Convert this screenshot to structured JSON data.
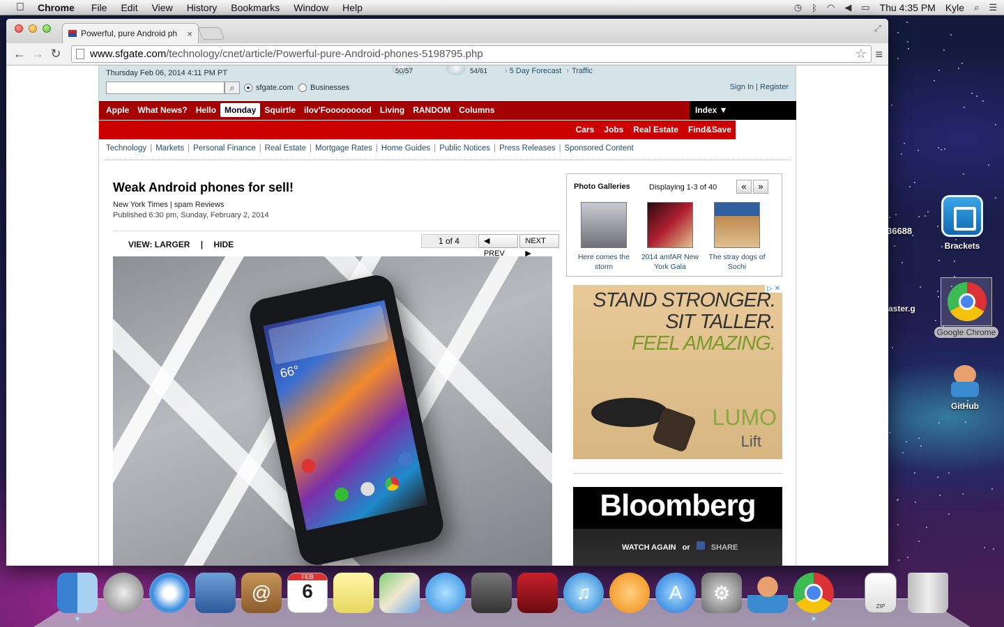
{
  "menubar": {
    "apple": "",
    "app": "Chrome",
    "items": [
      "File",
      "Edit",
      "View",
      "History",
      "Bookmarks",
      "Window",
      "Help"
    ],
    "clock": "Thu 4:35 PM",
    "user": "Kyle"
  },
  "browser": {
    "tab_title": "Powerful, pure Android ph",
    "tab_close": "×",
    "url_host": "www.sfgate.com",
    "url_path": "/technology/cnet/article/Powerful-pure-Android-phones-5198795.php",
    "star": "☆",
    "menu": "≡",
    "back": "←",
    "forward": "→",
    "reload": "↻",
    "fullscreen": "⤢"
  },
  "header": {
    "date": "Thursday Feb 06, 2014 4:11 PM PT",
    "weather1": "50/57",
    "weather2": "54/61",
    "forecast": "5 Day Forecast",
    "traffic": "Traffic",
    "radio1": "sfgate.com",
    "radio2": "Businesses",
    "signin": "Sign In",
    "register": "Register",
    "signin_sep": "|"
  },
  "nav": {
    "items": [
      "Apple",
      "What News?",
      "Hello",
      "Monday",
      "Squirtle",
      "ilov'Fooooooood",
      "Living",
      "RANDOM",
      "Columns"
    ],
    "active": "Monday",
    "index": "Index ▼",
    "sub": [
      "Cars",
      "Jobs",
      "Real Estate",
      "Find&Save"
    ]
  },
  "sections": [
    "Technology",
    "Markets",
    "Personal Finance",
    "Real Estate",
    "Mortgage Rates",
    "Home Guides",
    "Public Notices",
    "Press Releases",
    "Sponsored Content"
  ],
  "article": {
    "headline": "Weak Android phones for sell!",
    "byline": "New York Times | spam Reviews",
    "published": "Published 6:30 pm, Sunday, February 2, 2014",
    "view_larger": "VIEW: LARGER",
    "view_sep": "|",
    "hide": "HIDE",
    "page_count": "1 of 4",
    "prev": "◀ PREV",
    "next": "NEXT ▶",
    "phone_temp": "66°"
  },
  "galleries": {
    "title": "Photo Galleries",
    "count": "Displaying 1-3 of 40",
    "prev": "«",
    "next": "»",
    "items": [
      {
        "caption": "Here comes the storm",
        "color": "#8a8e94"
      },
      {
        "caption": "2014 amfAR New York Gala",
        "color": "#7a2030"
      },
      {
        "caption": "The stray dogs of Sochi",
        "color": "#b07a3a"
      }
    ]
  },
  "ad": {
    "line1": "STAND STRONGER.",
    "line2": "SIT TALLER.",
    "line3": "FEEL AMAZING.",
    "brand": "LUMO",
    "product": "Lift",
    "badge": "▷ ✕"
  },
  "bloomberg": {
    "logo": "Bloomberg",
    "watch": "WATCH AGAIN",
    "or": "or",
    "share": "SHARE"
  },
  "desktop": {
    "brackets": "Brackets",
    "chrome": "Google Chrome",
    "github": "GitHub",
    "frag1": "36688",
    "frag2": "aster.g"
  },
  "dock": {
    "calendar_month": "FEB",
    "calendar_day": "6",
    "zip": "ZIP"
  }
}
